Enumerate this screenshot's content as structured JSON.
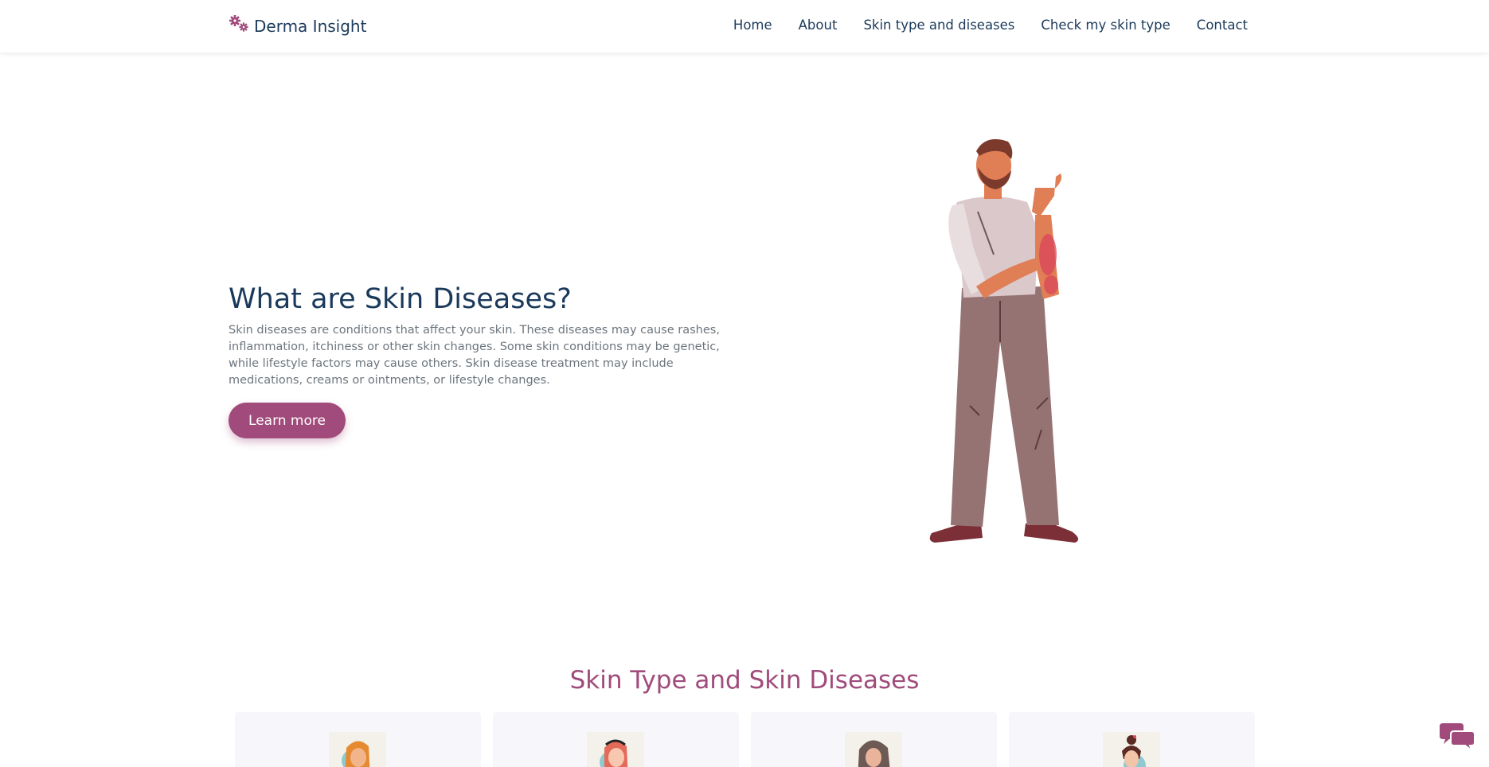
{
  "brand": {
    "name": "Derma Insight",
    "icon": "gears-icon"
  },
  "nav": {
    "items": [
      {
        "label": "Home"
      },
      {
        "label": "About"
      },
      {
        "label": "Skin type and diseases"
      },
      {
        "label": "Check my skin type"
      },
      {
        "label": "Contact"
      }
    ]
  },
  "hero": {
    "title": "What are Skin Diseases?",
    "text": "Skin diseases are conditions that affect your skin. These diseases may cause rashes, inflammation, itchiness or other skin changes. Some skin conditions may be genetic, while lifestyle factors may cause others. Skin disease treatment may include medications, creams or ointments, or lifestyle changes.",
    "button_label": "Learn more",
    "illustration": "man-with-skin-rash-illustration"
  },
  "section": {
    "title": "Skin Type and Skin Diseases",
    "cards": [
      {
        "avatar": "woman-orange-hair-avatar"
      },
      {
        "avatar": "woman-red-hair-avatar"
      },
      {
        "avatar": "woman-brown-hair-avatar"
      },
      {
        "avatar": "woman-bun-hair-avatar"
      }
    ]
  },
  "chat": {
    "icon": "chat-bubbles-icon"
  },
  "colors": {
    "accent": "#a04b7b",
    "navy": "#1b3a5b",
    "muted_text": "#6c757d",
    "card_bg": "#f7f7fb"
  }
}
